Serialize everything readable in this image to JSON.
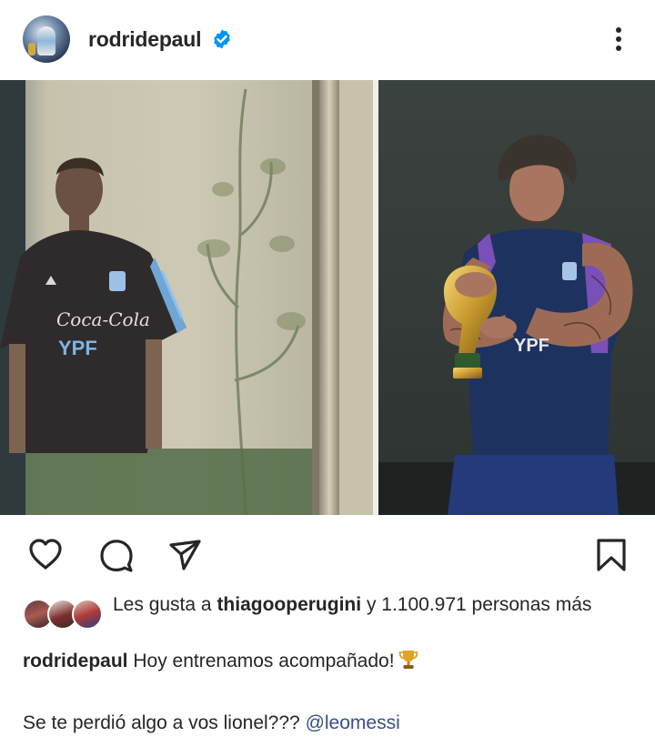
{
  "post": {
    "username": "rodridepaul",
    "verified": true,
    "likes": {
      "prefix": "Les gusta a",
      "liker": "thiagooperugini",
      "suffix": "y 1.100.971 personas más"
    },
    "caption": {
      "username": "rodridepaul",
      "text": "Hoy entrenamos acompañado!",
      "emoji": "trophy-icon",
      "line2_text": "Se te perdió algo a vos lionel???",
      "mention": "@leomessi"
    },
    "photo": {
      "left_shirt_sponsor": "Coca-Cola",
      "left_shirt_brand": "YPF",
      "right_shirt_brand": "YPF"
    }
  },
  "colors": {
    "text": "#262626",
    "verified": "#0095f6",
    "mention": "#385185"
  }
}
